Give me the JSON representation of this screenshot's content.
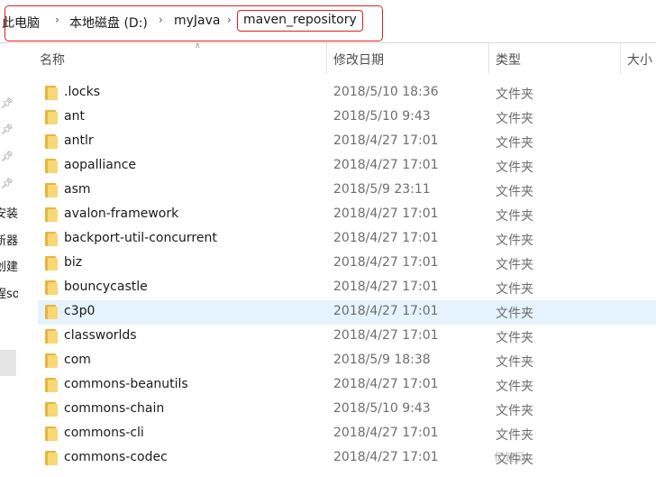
{
  "breadcrumb": {
    "items": [
      "此电脑",
      "本地磁盘 (D:)",
      "myJava",
      "maven_repository"
    ]
  },
  "nav": {
    "texts": [
      "安装",
      "新器",
      "创建",
      "程so"
    ]
  },
  "columns": {
    "name": "名称",
    "date": "修改日期",
    "type": "类型",
    "size": "大小"
  },
  "files": [
    {
      "name": ".locks",
      "date": "2018/5/10 18:36",
      "type": "文件夹"
    },
    {
      "name": "ant",
      "date": "2018/5/10 9:43",
      "type": "文件夹"
    },
    {
      "name": "antlr",
      "date": "2018/4/27 17:01",
      "type": "文件夹"
    },
    {
      "name": "aopalliance",
      "date": "2018/4/27 17:01",
      "type": "文件夹"
    },
    {
      "name": "asm",
      "date": "2018/5/9 23:11",
      "type": "文件夹"
    },
    {
      "name": "avalon-framework",
      "date": "2018/4/27 17:01",
      "type": "文件夹"
    },
    {
      "name": "backport-util-concurrent",
      "date": "2018/4/27 17:01",
      "type": "文件夹"
    },
    {
      "name": "biz",
      "date": "2018/4/27 17:01",
      "type": "文件夹"
    },
    {
      "name": "bouncycastle",
      "date": "2018/4/27 17:01",
      "type": "文件夹"
    },
    {
      "name": "c3p0",
      "date": "2018/4/27 17:01",
      "type": "文件夹",
      "selected": true
    },
    {
      "name": "classworlds",
      "date": "2018/4/27 17:01",
      "type": "文件夹"
    },
    {
      "name": "com",
      "date": "2018/5/9 18:38",
      "type": "文件夹"
    },
    {
      "name": "commons-beanutils",
      "date": "2018/4/27 17:01",
      "type": "文件夹"
    },
    {
      "name": "commons-chain",
      "date": "2018/5/10 9:43",
      "type": "文件夹"
    },
    {
      "name": "commons-cli",
      "date": "2018/4/27 17:01",
      "type": "文件夹"
    },
    {
      "name": "commons-codec",
      "date": "2018/4/27 17:01",
      "type": "文件夹"
    }
  ],
  "watermark": "亿速云",
  "colors": {
    "highlight_box": "#e02020",
    "selected_row": "#e5f3ff",
    "folder": "#f8d775"
  }
}
